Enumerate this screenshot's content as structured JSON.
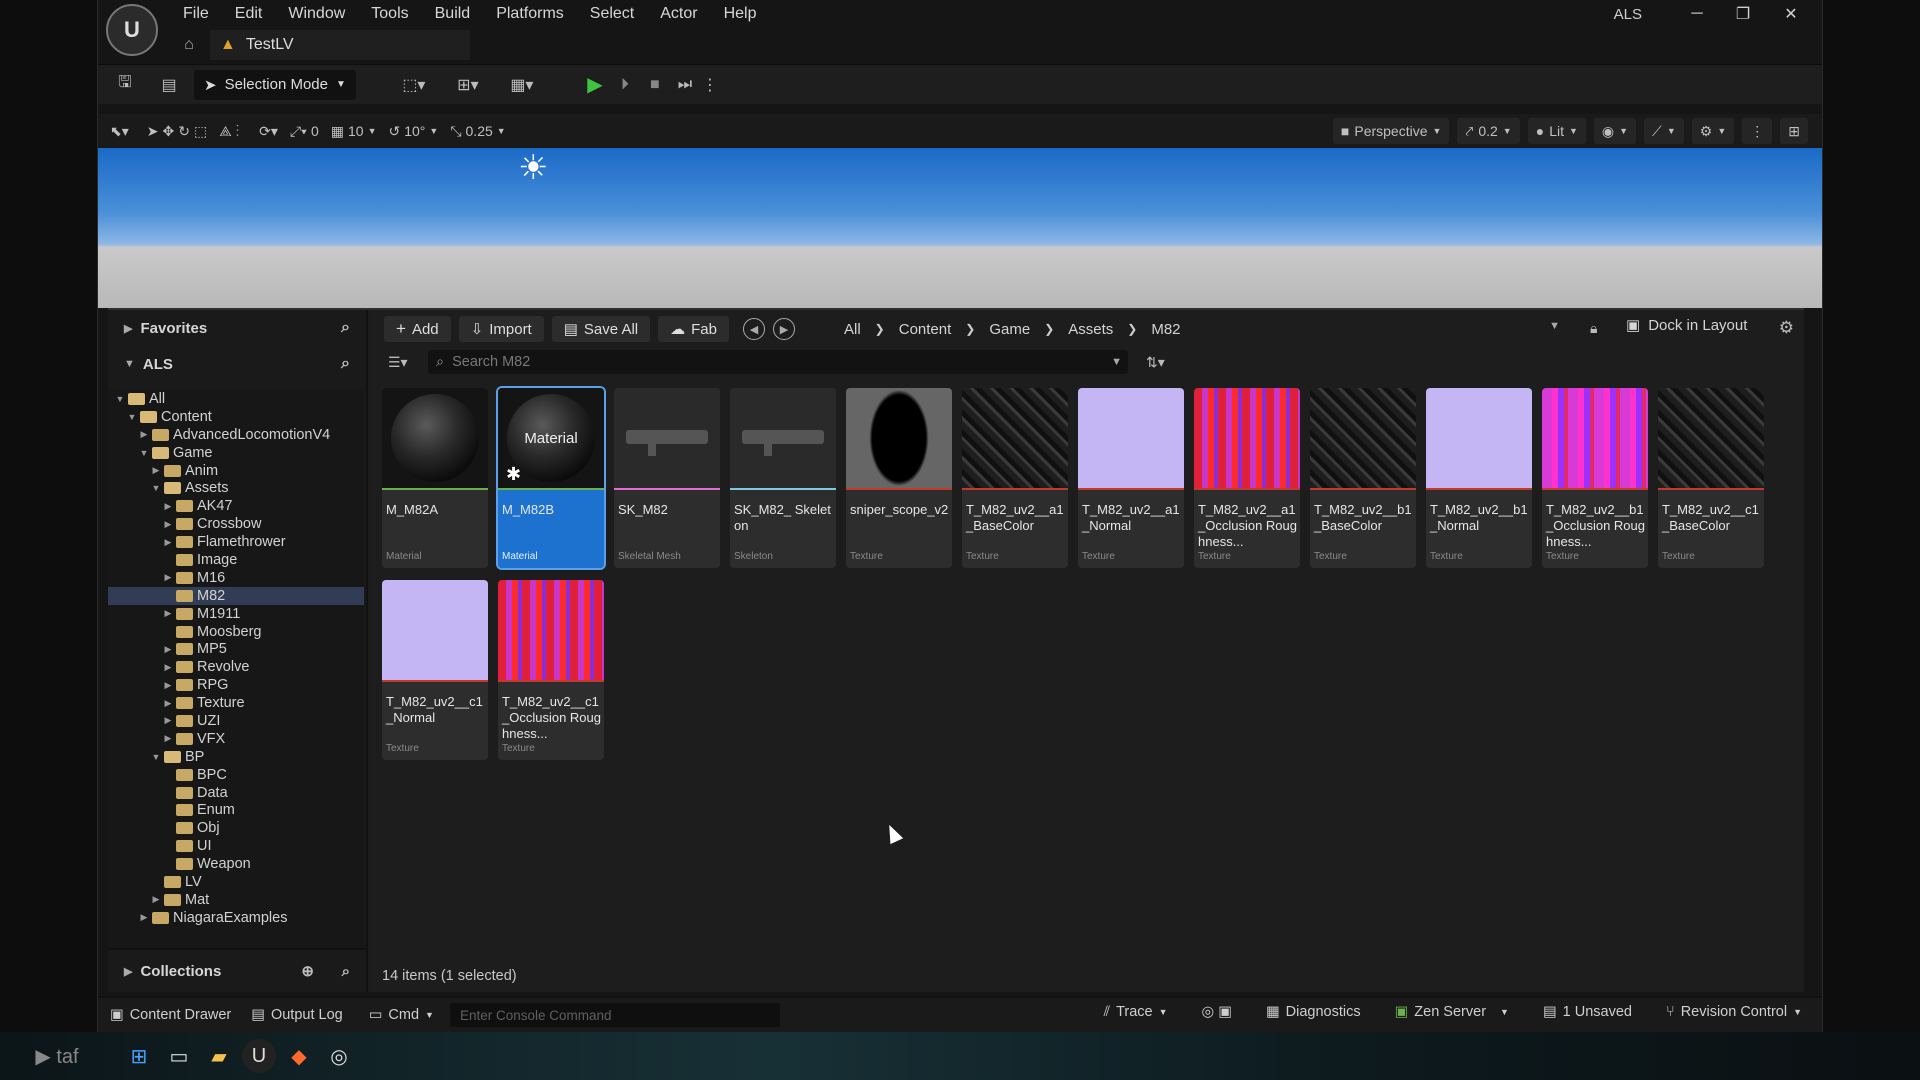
{
  "window": {
    "project": "ALS",
    "level_tab": "TestLV"
  },
  "menu": [
    "File",
    "Edit",
    "Window",
    "Tools",
    "Build",
    "Platforms",
    "Select",
    "Actor",
    "Help"
  ],
  "toolbar": {
    "selection_mode": "Selection Mode"
  },
  "viewport": {
    "snap_angle": "0",
    "grid": "10",
    "rotation": "10°",
    "scale": "0.25",
    "perspective": "Perspective",
    "camera_speed": "0.2",
    "view_mode": "Lit"
  },
  "sidebar": {
    "favorites": "Favorites",
    "project": "ALS",
    "collections": "Collections",
    "tree": [
      {
        "label": "All",
        "depth": 0,
        "open": true,
        "tw": "▼"
      },
      {
        "label": "Content",
        "depth": 1,
        "open": true,
        "tw": "▼"
      },
      {
        "label": "AdvancedLocomotionV4",
        "depth": 2,
        "tw": "▶"
      },
      {
        "label": "Game",
        "depth": 2,
        "open": true,
        "tw": "▼"
      },
      {
        "label": "Anim",
        "depth": 3,
        "tw": "▶"
      },
      {
        "label": "Assets",
        "depth": 3,
        "open": true,
        "tw": "▼"
      },
      {
        "label": "AK47",
        "depth": 4,
        "tw": "▶"
      },
      {
        "label": "Crossbow",
        "depth": 4,
        "tw": "▶"
      },
      {
        "label": "Flamethrower",
        "depth": 4,
        "tw": "▶"
      },
      {
        "label": "Image",
        "depth": 4,
        "tw": ""
      },
      {
        "label": "M16",
        "depth": 4,
        "tw": "▶"
      },
      {
        "label": "M82",
        "depth": 4,
        "tw": "",
        "selected": true
      },
      {
        "label": "M1911",
        "depth": 4,
        "tw": "▶"
      },
      {
        "label": "Moosberg",
        "depth": 4,
        "tw": ""
      },
      {
        "label": "MP5",
        "depth": 4,
        "tw": "▶"
      },
      {
        "label": "Revolve",
        "depth": 4,
        "tw": "▶"
      },
      {
        "label": "RPG",
        "depth": 4,
        "tw": "▶"
      },
      {
        "label": "Texture",
        "depth": 4,
        "tw": "▶"
      },
      {
        "label": "UZI",
        "depth": 4,
        "tw": "▶"
      },
      {
        "label": "VFX",
        "depth": 4,
        "tw": "▶"
      },
      {
        "label": "BP",
        "depth": 3,
        "open": true,
        "tw": "▼"
      },
      {
        "label": "BPC",
        "depth": 4,
        "tw": ""
      },
      {
        "label": "Data",
        "depth": 4,
        "tw": ""
      },
      {
        "label": "Enum",
        "depth": 4,
        "tw": ""
      },
      {
        "label": "Obj",
        "depth": 4,
        "tw": ""
      },
      {
        "label": "UI",
        "depth": 4,
        "tw": ""
      },
      {
        "label": "Weapon",
        "depth": 4,
        "tw": ""
      },
      {
        "label": "LV",
        "depth": 3,
        "tw": ""
      },
      {
        "label": "Mat",
        "depth": 3,
        "tw": "▶"
      },
      {
        "label": "NiagaraExamples",
        "depth": 2,
        "tw": "▶"
      }
    ]
  },
  "cbtoolbar": {
    "add": "Add",
    "import": "Import",
    "save_all": "Save All",
    "fab": "Fab",
    "dock": "Dock in Layout",
    "search_placeholder": "Search M82"
  },
  "breadcrumbs": [
    "All",
    "Content",
    "Game",
    "Assets",
    "M82"
  ],
  "assets": [
    {
      "name": "M_M82A",
      "type": "Material",
      "kind": "sphere",
      "accent": "#6ab04c"
    },
    {
      "name": "M_M82B",
      "type": "Material",
      "kind": "sphere-selected",
      "accent": "#6ab04c",
      "overlay": "Material",
      "selected": true
    },
    {
      "name": "SK_M82",
      "type": "Skeletal Mesh",
      "kind": "gun",
      "accent": "#e36bd2"
    },
    {
      "name": "SK_M82_ Skeleton",
      "type": "Skeleton",
      "kind": "gun",
      "accent": "#7ec8e3"
    },
    {
      "name": "sniper_scope_v2",
      "type": "Texture",
      "kind": "scope",
      "accent": "#c0392b"
    },
    {
      "name": "T_M82_uv2__a1 _BaseColor",
      "type": "Texture",
      "kind": "dark",
      "accent": "#c0392b"
    },
    {
      "name": "T_M82_uv2__a1 _Normal",
      "type": "Texture",
      "kind": "normal",
      "accent": "#c0392b"
    },
    {
      "name": "T_M82_uv2__a1 _Occlusion Roughness...",
      "type": "Texture",
      "kind": "orm",
      "accent": "#c0392b"
    },
    {
      "name": "T_M82_uv2__b1 _BaseColor",
      "type": "Texture",
      "kind": "dark",
      "accent": "#c0392b"
    },
    {
      "name": "T_M82_uv2__b1 _Normal",
      "type": "Texture",
      "kind": "normal",
      "accent": "#c0392b"
    },
    {
      "name": "T_M82_uv2__b1 _Occlusion Roughness...",
      "type": "Texture",
      "kind": "orm2",
      "accent": "#c0392b"
    },
    {
      "name": "T_M82_uv2__c1 _BaseColor",
      "type": "Texture",
      "kind": "dark",
      "accent": "#c0392b"
    },
    {
      "name": "T_M82_uv2__c1 _Normal",
      "type": "Texture",
      "kind": "normal",
      "accent": "#c0392b"
    },
    {
      "name": "T_M82_uv2__c1 _Occlusion Roughness...",
      "type": "Texture",
      "kind": "orm",
      "accent": "#c0392b"
    }
  ],
  "status": {
    "items": "14 items (1 selected)"
  },
  "bottom": {
    "content_drawer": "Content Drawer",
    "output_log": "Output Log",
    "cmd": "Cmd",
    "console_placeholder": "Enter Console Command",
    "trace": "Trace",
    "diagnostics": "Diagnostics",
    "zen_server": "Zen Server",
    "unsaved": "1 Unsaved",
    "revision_control": "Revision Control"
  }
}
